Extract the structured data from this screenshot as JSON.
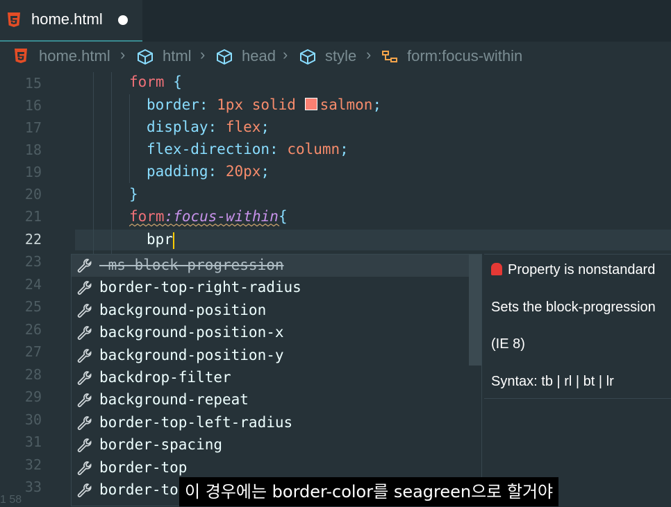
{
  "tab": {
    "label": "home.html"
  },
  "breadcrumb": [
    "home.html",
    "html",
    "head",
    "style",
    "form:focus-within"
  ],
  "editor": {
    "lines": [
      {
        "n": "15"
      },
      {
        "n": "16"
      },
      {
        "n": "17"
      },
      {
        "n": "18"
      },
      {
        "n": "19"
      },
      {
        "n": "20"
      },
      {
        "n": "21"
      },
      {
        "n": "22"
      },
      {
        "n": "23"
      },
      {
        "n": "24"
      },
      {
        "n": "25"
      },
      {
        "n": "26"
      },
      {
        "n": "27"
      },
      {
        "n": "28"
      },
      {
        "n": "29"
      },
      {
        "n": "30"
      },
      {
        "n": "31"
      },
      {
        "n": "32"
      },
      {
        "n": "33"
      }
    ],
    "code": {
      "l15_sel": "form",
      "l15_brace": " {",
      "l16_prop": "border",
      "l16_colon": ": ",
      "l16_val1": "1px solid ",
      "l16_val2": "salmon",
      "l16_semi": ";",
      "l17_prop": "display",
      "l17_colon": ": ",
      "l17_val": "flex",
      "l17_semi": ";",
      "l18_prop": "flex-direction",
      "l18_colon": ": ",
      "l18_val": "column",
      "l18_semi": ";",
      "l19_prop": "padding",
      "l19_colon": ": ",
      "l19_val": "20px",
      "l19_semi": ";",
      "l20_brace": "}",
      "l21_sel": "form",
      "l21_pseudo": ":focus-within",
      "l21_brace": "{",
      "l22_typed": "bpr"
    },
    "swatch_color": "#fa8072"
  },
  "suggestions": [
    {
      "label": "-ms-block-progression",
      "deprecated": true
    },
    {
      "label": "border-top-right-radius"
    },
    {
      "label": "background-position"
    },
    {
      "label": "background-position-x"
    },
    {
      "label": "background-position-y"
    },
    {
      "label": "backdrop-filter"
    },
    {
      "label": "background-repeat"
    },
    {
      "label": "border-top-left-radius"
    },
    {
      "label": "border-spacing"
    },
    {
      "label": "border-top"
    },
    {
      "label": "border-to"
    }
  ],
  "details": {
    "warning": "Property is nonstandard",
    "description": "Sets the block-progression",
    "browsers": "(IE 8)",
    "syntax": "Syntax: tb | rl | bt | lr"
  },
  "subtitle": "이 경우에는 border-color를 seagreen으로 할거야",
  "status_peek": "1    58",
  "colors": {
    "accent": "#80cbc4",
    "cursor": "#ffcc00",
    "warning": "#f07178"
  }
}
